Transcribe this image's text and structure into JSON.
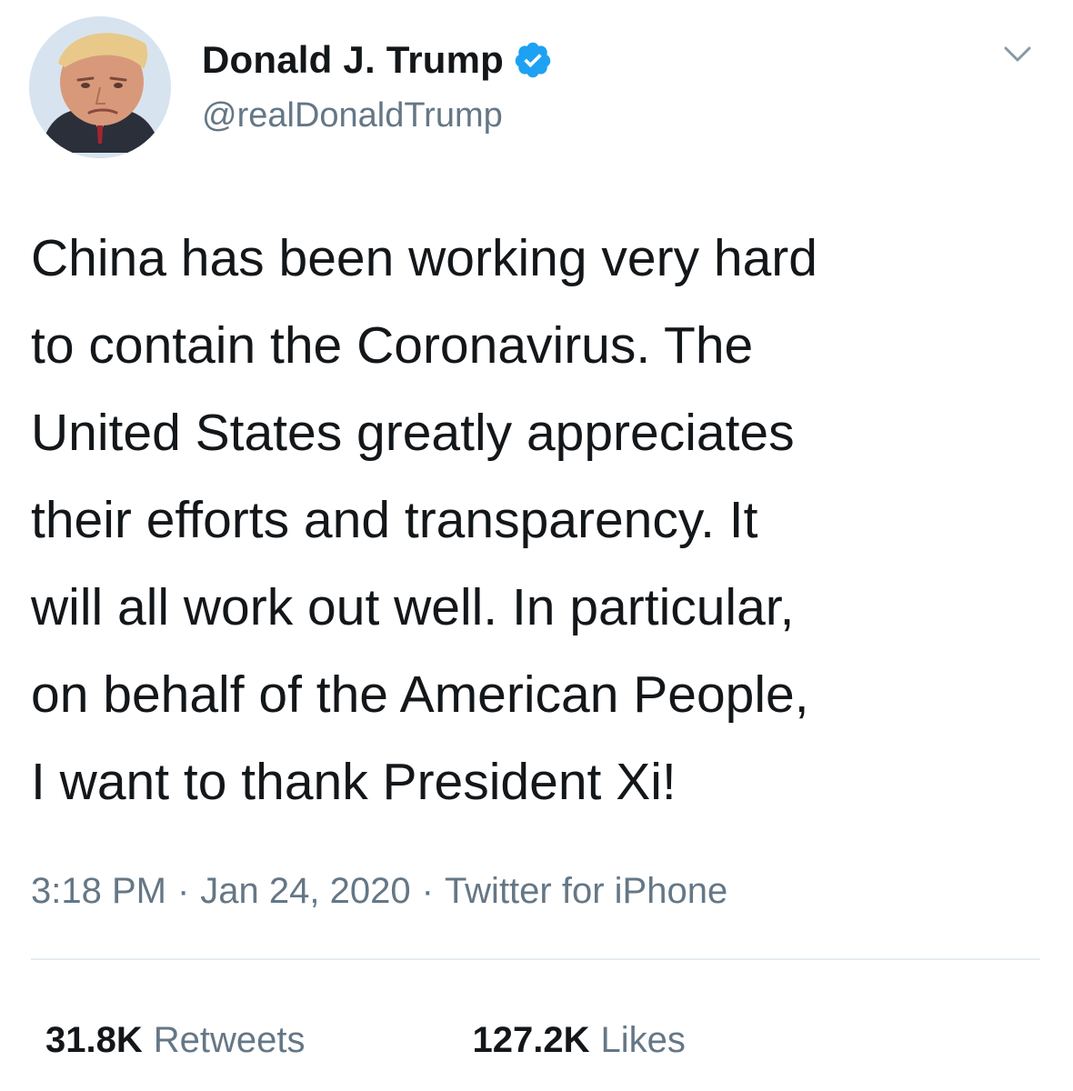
{
  "user": {
    "display_name": "Donald J. Trump",
    "handle": "@realDonaldTrump",
    "verified": true,
    "verified_color": "#1da1f2"
  },
  "tweet": {
    "text": "China has been working very hard\nto contain the Coronavirus. The\nUnited States greatly appreciates\ntheir efforts and transparency. It\nwill all work out well. In particular,\non behalf of the American People,\nI want to thank President Xi!",
    "time": "3:18 PM",
    "date": "Jan 24, 2020",
    "source": "Twitter for iPhone",
    "separator": "·"
  },
  "stats": {
    "retweets_count": "31.8K",
    "retweets_label": "Retweets",
    "likes_count": "127.2K",
    "likes_label": "Likes"
  },
  "icons": {
    "menu": "chevron-down-icon",
    "verified": "verified-badge-icon"
  }
}
